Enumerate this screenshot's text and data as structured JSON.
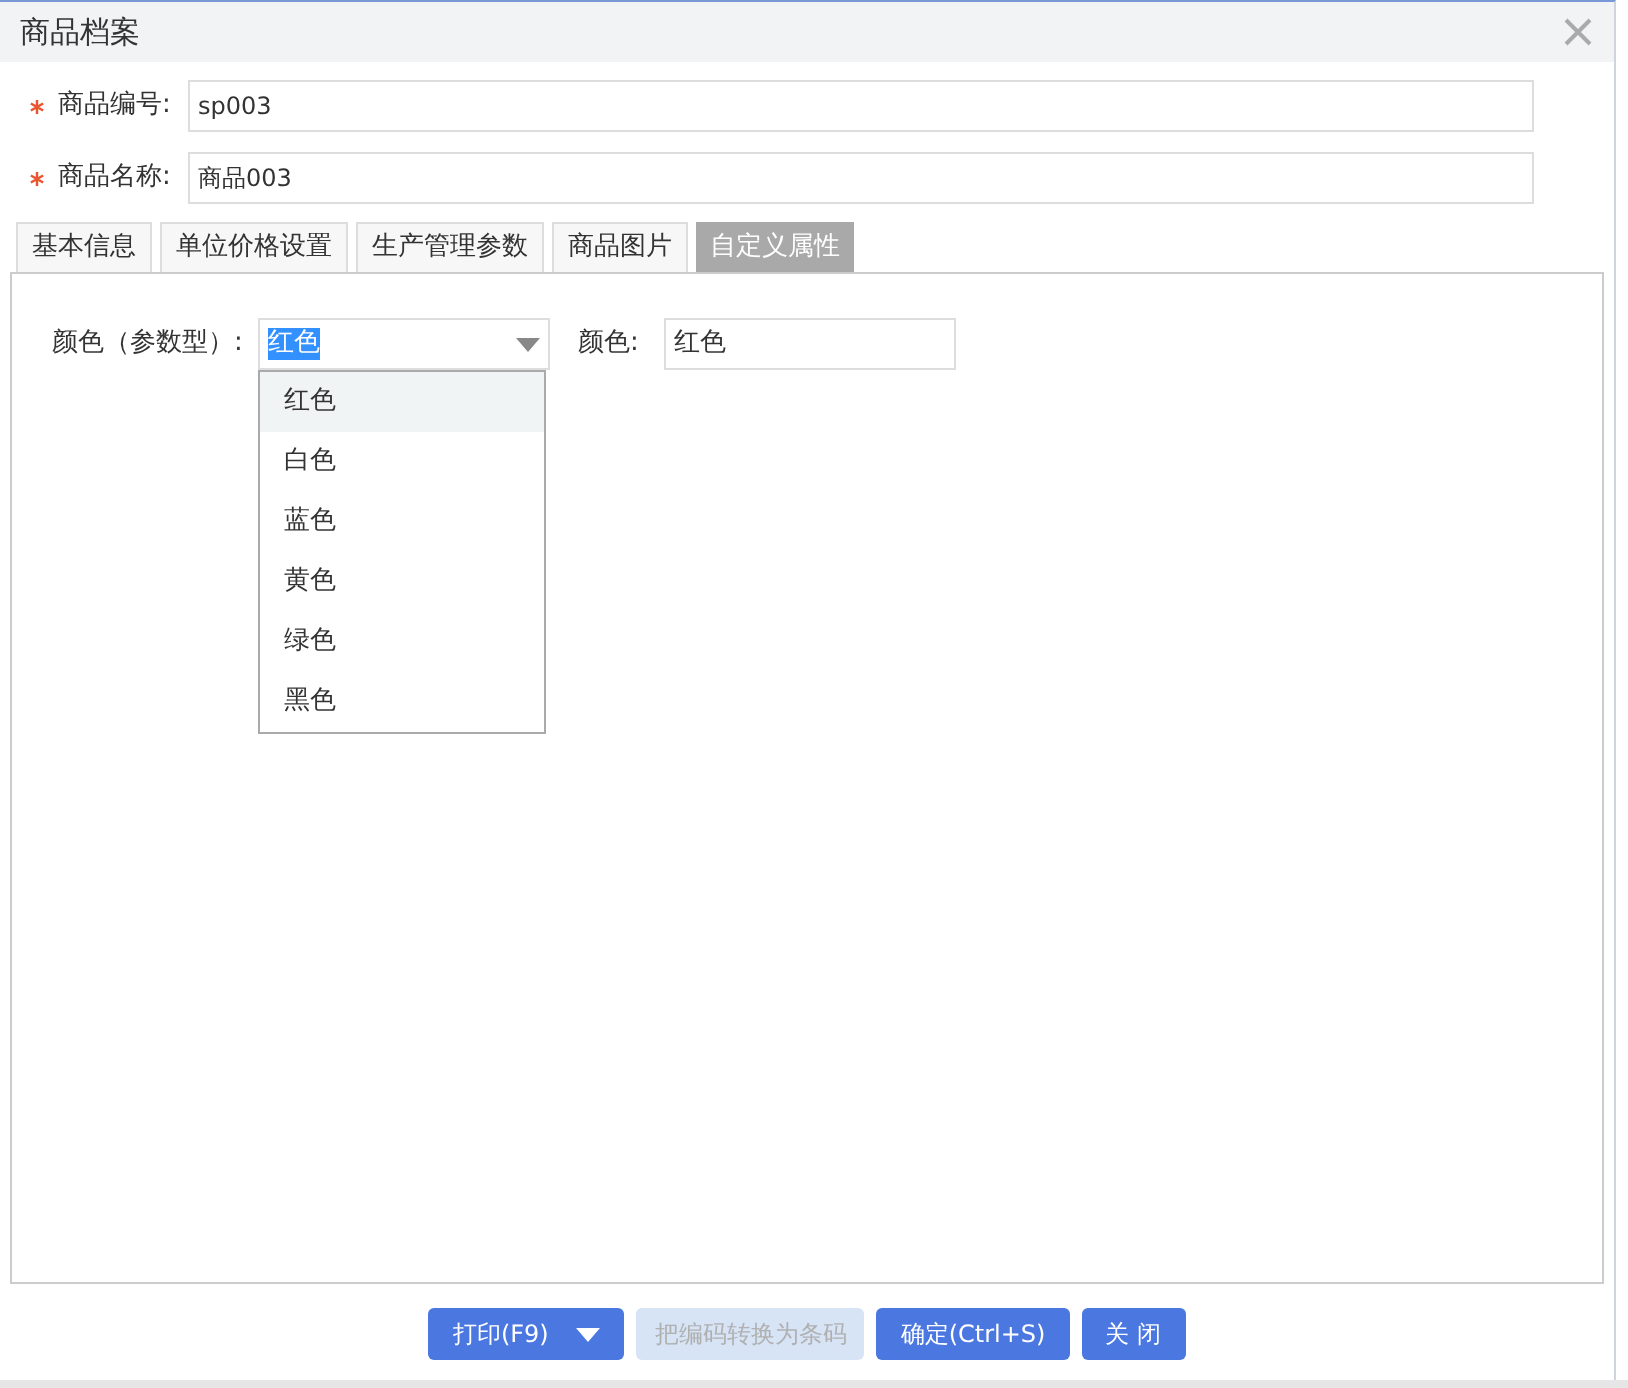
{
  "window": {
    "title": "商品档案"
  },
  "fields": [
    {
      "label": "商品编号:",
      "required": true,
      "value": "sp003"
    },
    {
      "label": "商品名称:",
      "required": true,
      "value": "商品003"
    }
  ],
  "tabs": [
    {
      "label": "基本信息",
      "selected": false
    },
    {
      "label": "单位价格设置",
      "selected": false
    },
    {
      "label": "生产管理参数",
      "selected": false
    },
    {
      "label": "商品图片",
      "selected": false
    },
    {
      "label": "自定义属性",
      "selected": true
    }
  ],
  "attribute_select": {
    "label": "颜色（参数型）:",
    "value": "红色",
    "text_highlighted": true,
    "expanded": true,
    "options": [
      {
        "label": "红色",
        "selected": true
      },
      {
        "label": "白色",
        "selected": false
      },
      {
        "label": "蓝色",
        "selected": false
      },
      {
        "label": "黄色",
        "selected": false
      },
      {
        "label": "绿色",
        "selected": false
      },
      {
        "label": "黑色",
        "selected": false
      }
    ]
  },
  "attribute_field": {
    "label": "颜色:",
    "value": "红色"
  },
  "buttons": [
    {
      "label": "打印(F9)",
      "kind": "split",
      "disabled": false
    },
    {
      "label": "把编码转换为条码",
      "kind": "plain",
      "disabled": true
    },
    {
      "label": "确定(Ctrl+S)",
      "kind": "plain",
      "disabled": false
    },
    {
      "label": "关 闭",
      "kind": "plain",
      "disabled": false
    }
  ]
}
